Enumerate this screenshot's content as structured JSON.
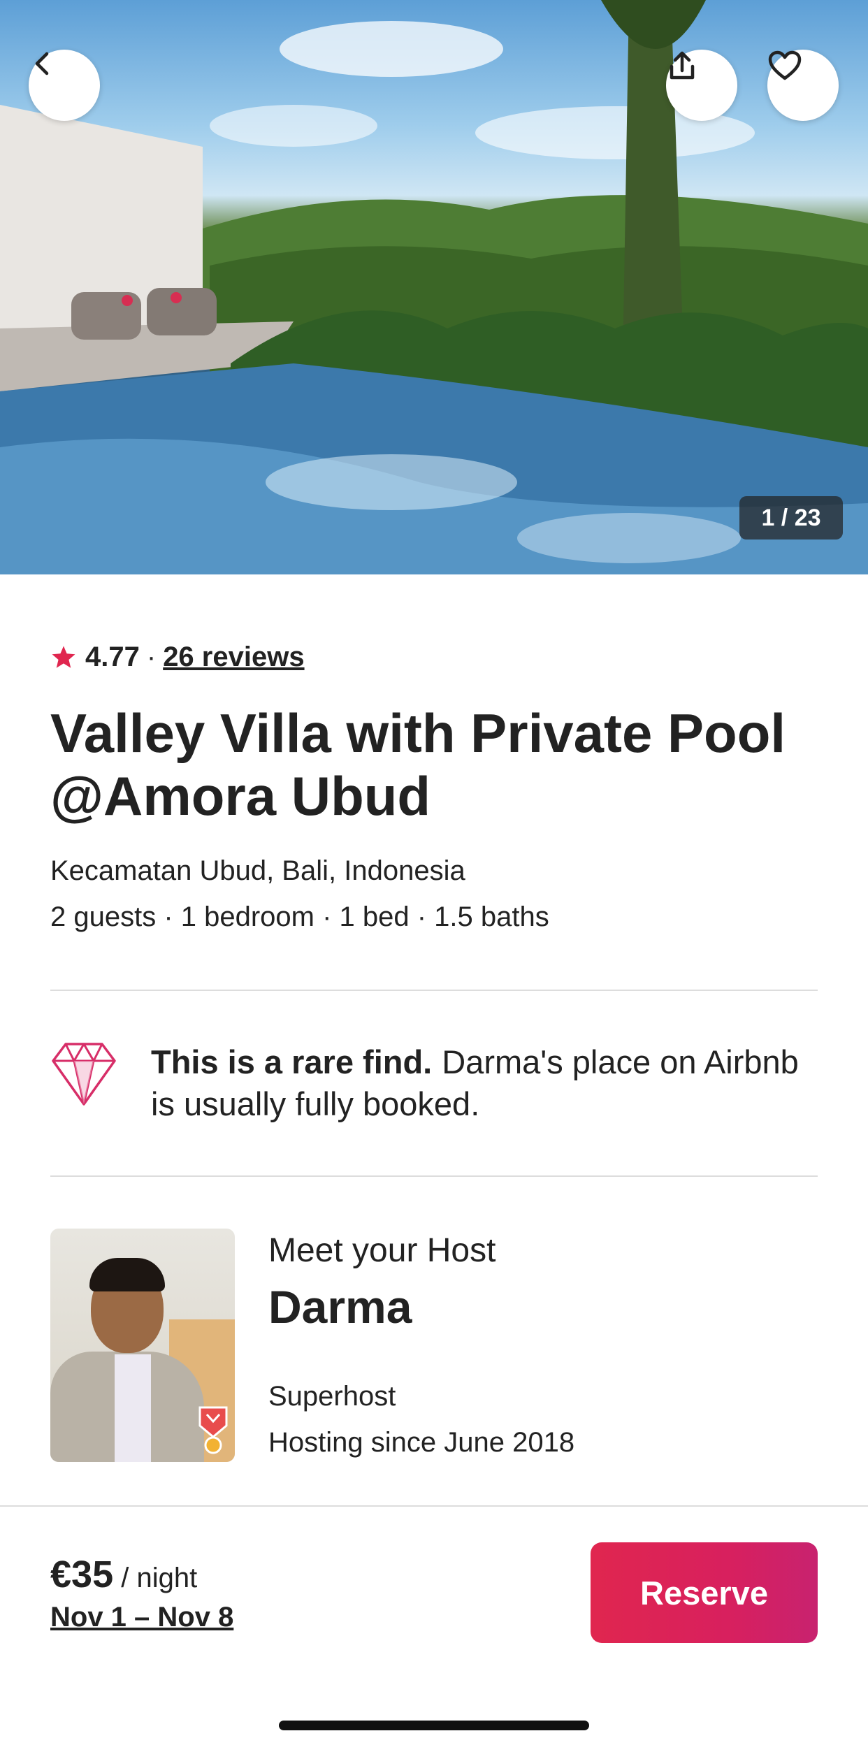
{
  "hero": {
    "photo_counter": "1 / 23",
    "back_icon": "chevron-left-icon",
    "share_icon": "share-icon",
    "save_icon": "heart-icon"
  },
  "listing": {
    "rating": "4.77",
    "separator": "·",
    "reviews": "26 reviews",
    "title": "Valley Villa with Private Pool @Amora Ubud",
    "location": "Kecamatan Ubud, Bali, Indonesia",
    "specs": "2 guests · 1 bedroom · 1 bed · 1.5 baths"
  },
  "rare_find": {
    "icon": "diamond-icon",
    "headline": "This is a rare find.",
    "body": "Darma's place on Airbnb is usually fully booked."
  },
  "host": {
    "meet_label": "Meet your Host",
    "name": "Darma",
    "status": "Superhost",
    "since": "Hosting since June 2018"
  },
  "footer": {
    "price": "€35",
    "per_night": "/ night",
    "dates": "Nov 1 – Nov 8",
    "reserve_label": "Reserve"
  },
  "colors": {
    "brand": "#E0264F",
    "text": "#222222",
    "divider": "#DDDDDD"
  }
}
